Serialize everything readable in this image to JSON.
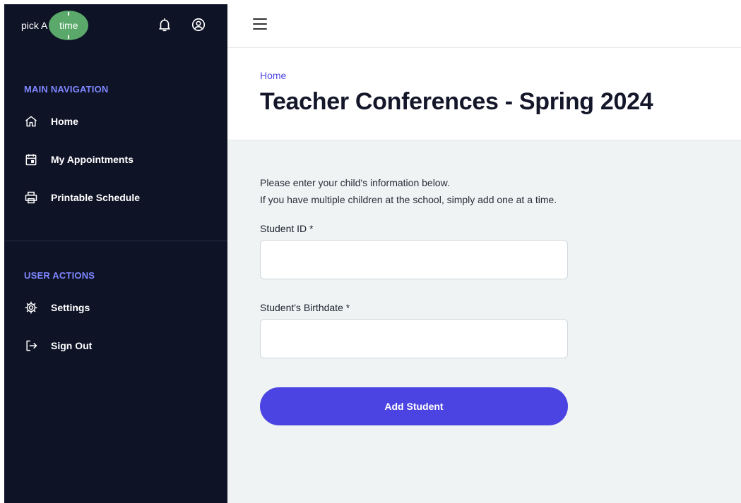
{
  "app": {
    "logo_prefix": "pick A",
    "logo_circle_text": "time"
  },
  "sidebar": {
    "main_nav_title": "MAIN NAVIGATION",
    "main_items": [
      {
        "label": "Home",
        "icon": "home-icon"
      },
      {
        "label": "My Appointments",
        "icon": "calendar-icon"
      },
      {
        "label": "Printable Schedule",
        "icon": "printer-icon"
      }
    ],
    "user_actions_title": "USER ACTIONS",
    "user_items": [
      {
        "label": "Settings",
        "icon": "gear-icon"
      },
      {
        "label": "Sign Out",
        "icon": "sign-out-icon"
      }
    ]
  },
  "header": {
    "breadcrumb": "Home",
    "title": "Teacher Conferences - Spring 2024"
  },
  "form": {
    "intro_line1": "Please enter your child's information below.",
    "intro_line2": "If you have multiple children at the school, simply add one at a time.",
    "student_id_label": "Student ID *",
    "student_id_value": "",
    "birthdate_label": "Student's Birthdate *",
    "birthdate_value": "",
    "submit_label": "Add Student"
  },
  "colors": {
    "sidebar_bg": "#0f1326",
    "section_title": "#7e87ff",
    "accent": "#4b44e2",
    "logo_green": "#5aa86a",
    "content_bg": "#eff3f3"
  }
}
